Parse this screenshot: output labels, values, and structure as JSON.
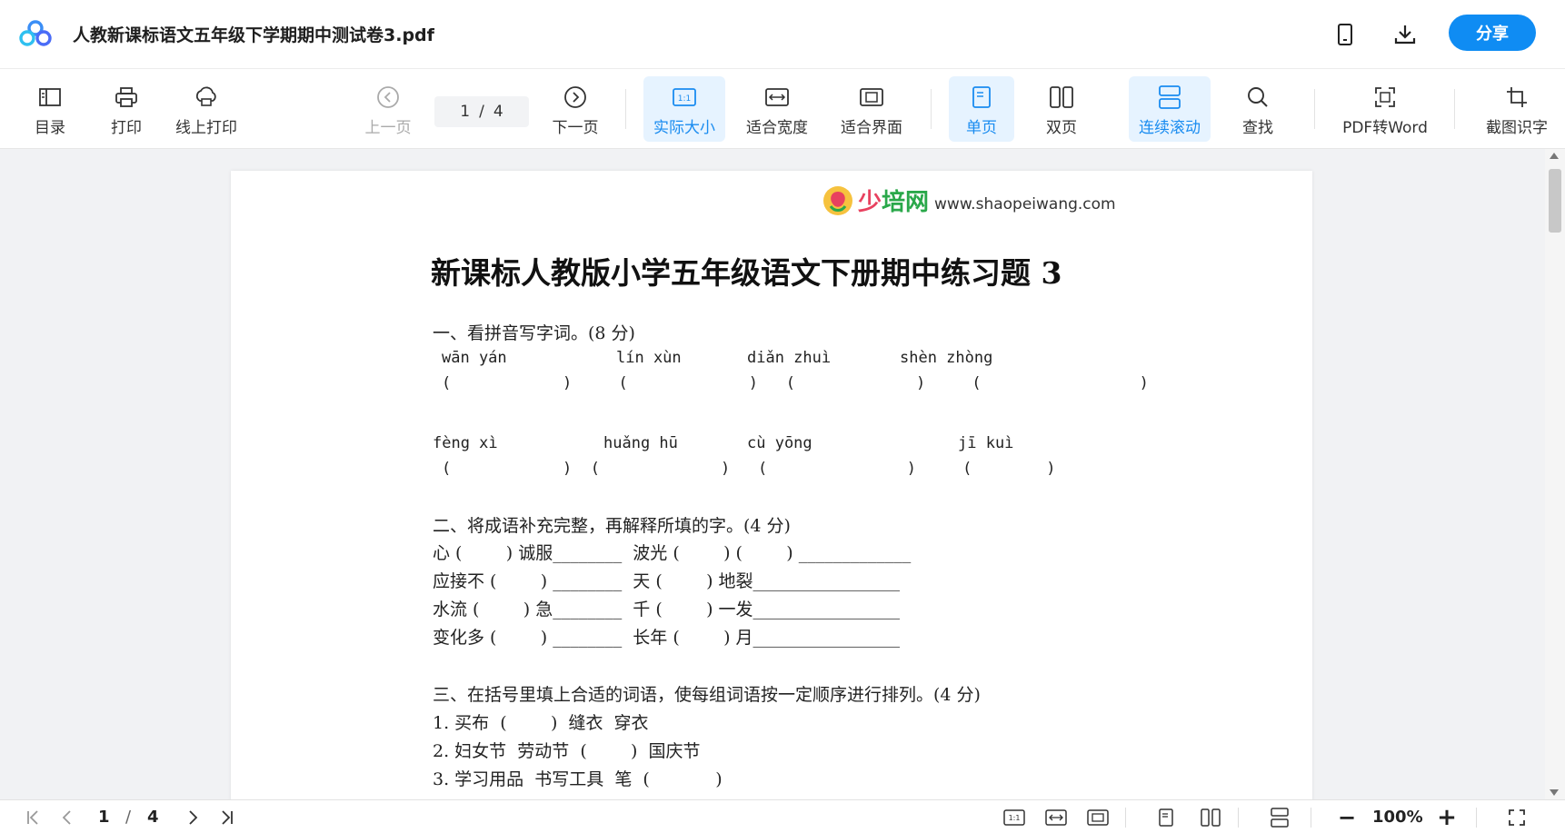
{
  "titlebar": {
    "title": "人教新课标语文五年级下学期期中测试卷3.pdf",
    "share_label": "分享",
    "icons": [
      "app-logo",
      "mobile-icon",
      "download-icon"
    ]
  },
  "toolbar": {
    "toc": "目录",
    "print": "打印",
    "online_print": "线上打印",
    "prev": "上一页",
    "current_page": "1",
    "page_sep": "/",
    "total_pages": "4",
    "next": "下一页",
    "actual_size": "实际大小",
    "fit_width": "适合宽度",
    "fit_page": "适合界面",
    "single": "单页",
    "double": "双页",
    "continuous": "连续滚动",
    "find": "查找",
    "pdf_to_word": "PDF转Word",
    "ocr": "截图识字",
    "accent": "#1a8cf0"
  },
  "document": {
    "brand_a": "少",
    "brand_b": "培网",
    "url": "www.shaopeiwang.com",
    "heading": "新课标人教版小学五年级语文下册期中练习题 3",
    "s1_title": "一、看拼音写字词。(8 分)",
    "s1_pinyin_1": [
      "wān yán",
      "lín xùn",
      "diǎn zhuì",
      "shèn zhòng"
    ],
    "s1_paren_1": "(            )     (             )   (             )     (                 )",
    "s1_pinyin_2": [
      "fèng xì",
      "huǎng hū",
      "cù yōng",
      "jī kuì"
    ],
    "s1_paren_2": "(            )  (             )   (               )     (        )",
    "s2_title": "二、将成语补充完整，再解释所填的字。(4 分)",
    "s2_lines": [
      "心 (        ) 诚服________  波光 (        ) (        ) _____________",
      "应接不 (        ) ________  天 (        ) 地裂_________________",
      "水流 (        ) 急________  千 (        ) 一发_________________",
      "变化多 (        ) ________  长年 (        ) 月_________________"
    ],
    "s3_title": "三、在括号里填上合适的词语，使每组词语按一定顺序进行排列。(4 分)",
    "s3_lines": [
      "1. 买布  (        )  缝衣  穿衣",
      "2. 妇女节  劳动节  (        )  国庆节",
      "3. 学习用品  书写工具  笔  (            )"
    ]
  },
  "statusbar": {
    "current_page": "1",
    "page_sep": "/",
    "total_pages": "4",
    "zoom": "100%",
    "minus": "−",
    "plus": "+"
  }
}
